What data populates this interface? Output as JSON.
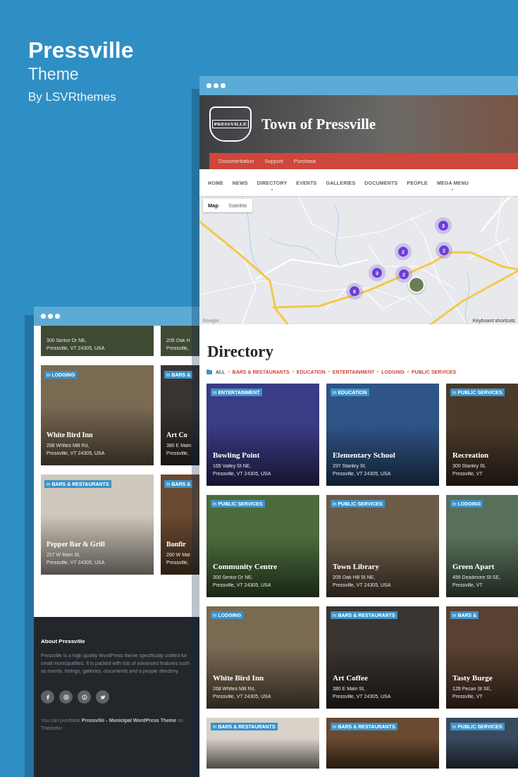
{
  "promo": {
    "title": "Pressville",
    "subtitle": "Theme",
    "author": "By LSVRthemes"
  },
  "back_window": {
    "cards_top": [
      {
        "address": [
          "300 Senior Dr NE,",
          "Pressville, VT 24305, USA"
        ]
      },
      {
        "address": [
          "205 Oak H",
          "Pressville,"
        ]
      }
    ],
    "cards": [
      {
        "tag": "in **LODGING**",
        "title": "White Bird Inn",
        "address": [
          "268 Whites Mill Rd,",
          "Pressville, VT 24305, USA"
        ]
      },
      {
        "tag": "in **BARS &**",
        "title": "Art Co",
        "address": [
          "380 E Main",
          "Pressville,"
        ]
      },
      {
        "tag": "in **BARS & RESTAURANTS**",
        "title": "Pepper Bar & Grill",
        "address": [
          "217 W Main St,",
          "Pressville, VT 24305, USA"
        ]
      },
      {
        "tag": "in **BARS &**",
        "title": "Bonfir",
        "address": [
          "260 W Mai",
          "Pressville,"
        ]
      }
    ],
    "footer": {
      "heading": "About Pressville",
      "text": "Pressville is a high quality WordPress theme specifically crafted for small municipalities. It is packed with lots of advanced features such as events, listings, galleries, documents and a people directory.",
      "social": [
        {
          "kind": "facebook"
        },
        {
          "kind": "instagram"
        },
        {
          "kind": "pinterest"
        },
        {
          "kind": "twitter"
        }
      ],
      "purchase": "You can purchase **Pressville - Municipal WordPress Theme** on Themefor"
    }
  },
  "front_window": {
    "logo_text": "PRESSVILLE",
    "site_title": "Town of Pressville",
    "top_links": [
      "Documentation",
      "Support",
      "Purchase"
    ],
    "nav": [
      {
        "label": "HOME",
        "has_dropdown": false
      },
      {
        "label": "NEWS",
        "has_dropdown": false
      },
      {
        "label": "DIRECTORY",
        "has_dropdown": true
      },
      {
        "label": "EVENTS",
        "has_dropdown": false
      },
      {
        "label": "GALLERIES",
        "has_dropdown": false
      },
      {
        "label": "DOCUMENTS",
        "has_dropdown": false
      },
      {
        "label": "PEOPLE",
        "has_dropdown": false
      },
      {
        "label": "MEGA MENU",
        "has_dropdown": true
      }
    ],
    "map": {
      "type_buttons": [
        {
          "label": "Map",
          "selected": true
        },
        {
          "label": "Satellite",
          "selected": false
        }
      ],
      "clusters": [
        "3",
        "2",
        "2",
        "3",
        "2",
        "6"
      ],
      "logo": "Google",
      "shortcuts": "Keyboard shortcuts"
    },
    "heading": "Directory",
    "filters": [
      {
        "label": "ALL",
        "selected": true
      },
      {
        "label": "BARS & RESTAURANTS",
        "selected": false
      },
      {
        "label": "EDUCATION",
        "selected": false
      },
      {
        "label": "ENTERTAINMENT",
        "selected": false
      },
      {
        "label": "LODGING",
        "selected": false
      },
      {
        "label": "PUBLIC SERVICES",
        "selected": false
      }
    ],
    "cards": [
      {
        "tag": "in **ENTERTAINMENT**",
        "title": "Bowling Point",
        "address": [
          "165 Valley St NE,",
          "Pressville, VT 24305, USA"
        ]
      },
      {
        "tag": "in **EDUCATION**",
        "title": "Elementary School",
        "address": [
          "297 Stanley St,",
          "Pressville, VT 24305, USA"
        ]
      },
      {
        "tag": "in **PUBLIC SERVICES**",
        "title": "Recreation",
        "address": [
          "300 Stanley St,",
          "Pressville, VT"
        ]
      },
      {
        "tag": "in **PUBLIC SERVICES**",
        "title": "Community Centre",
        "address": [
          "300 Senior Dr NE,",
          "Pressville, VT 24305, USA"
        ]
      },
      {
        "tag": "in **PUBLIC SERVICES**",
        "title": "Town Library",
        "address": [
          "205 Oak Hill St NE,",
          "Pressville, VT 24305, USA"
        ]
      },
      {
        "tag": "in **LODGING**",
        "title": "Green Apart",
        "address": [
          "459 Deadmore St SE,",
          "Pressville, VT"
        ]
      },
      {
        "tag": "in **LODGING**",
        "title": "White Bird Inn",
        "address": [
          "268 Whites Mill Rd,",
          "Pressville, VT 24305, USA"
        ]
      },
      {
        "tag": "in **BARS & RESTAURANTS**",
        "title": "Art Coffee",
        "address": [
          "380 E Main St,",
          "Pressville, VT 24305, USA"
        ]
      },
      {
        "tag": "in **BARS &**",
        "title": "Tasty Burge",
        "address": [
          "128 Pecan St SE,",
          "Pressville, VT"
        ]
      },
      {
        "tag": "in **BARS & RESTAURANTS**"
      },
      {
        "tag": "in **BARS & RESTAURANTS**"
      },
      {
        "tag": "in **PUBLIC SERVICES**"
      }
    ]
  }
}
